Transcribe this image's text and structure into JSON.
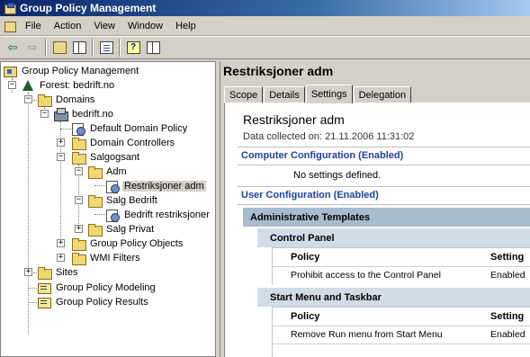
{
  "window": {
    "title": "Group Policy Management"
  },
  "menu": {
    "items": [
      "File",
      "Action",
      "View",
      "Window",
      "Help"
    ]
  },
  "tree": {
    "root": "Group Policy Management",
    "forest": "Forest: bedrift.no",
    "domains": "Domains",
    "domain": "bedrift.no",
    "default_policy": "Default Domain Policy",
    "domain_controllers": "Domain Controllers",
    "salgogsant": "Salgogsant",
    "adm": "Adm",
    "restriksjoner_adm": "Restriksjoner adm",
    "salg_bedrift": "Salg Bedrift",
    "bedrift_restriksjoner": "Bedrift restriksjoner",
    "salg_privat": "Salg Privat",
    "gpo_objects": "Group Policy Objects",
    "wmi_filters": "WMI Filters",
    "sites": "Sites",
    "modeling": "Group Policy Modeling",
    "results": "Group Policy Results"
  },
  "right": {
    "title": "Restriksjoner adm",
    "tabs": [
      "Scope",
      "Details",
      "Settings",
      "Delegation"
    ],
    "active_tab": "Settings",
    "report_title": "Restriksjoner adm",
    "data_collected": "Data collected on: 21.11.2006 11:31:02",
    "computer_config": "Computer Configuration (Enabled)",
    "no_settings": "No settings defined.",
    "user_config": "User Configuration (Enabled)",
    "admin_templates": "Administrative Templates",
    "groups": [
      {
        "name": "Control Panel",
        "col_policy": "Policy",
        "col_setting": "Setting",
        "rows": [
          {
            "policy": "Prohibit access to the Control Panel",
            "setting": "Enabled"
          }
        ]
      },
      {
        "name": "Start Menu and Taskbar",
        "col_policy": "Policy",
        "col_setting": "Setting",
        "rows": [
          {
            "policy": "Remove Run menu from Start Menu",
            "setting": "Enabled"
          }
        ]
      }
    ]
  }
}
